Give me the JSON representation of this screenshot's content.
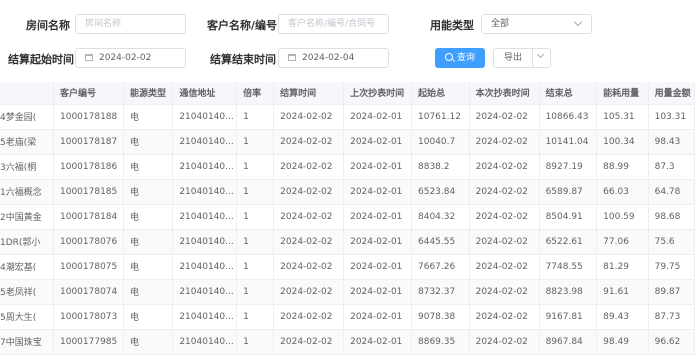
{
  "filters": {
    "room_name": {
      "label": "房间名称",
      "placeholder": "房间名称"
    },
    "customer": {
      "label": "客户名称/编号",
      "placeholder": "客户名称/编号/合同号"
    },
    "energy_type": {
      "label": "用能类型",
      "value": "全部"
    },
    "start": {
      "label": "结算起始时间",
      "value": "2024-02-02"
    },
    "end": {
      "label": "结算结束时间",
      "value": "2024-02-04"
    }
  },
  "buttons": {
    "query": "查询",
    "export": "导出"
  },
  "table": {
    "headers": [
      "",
      "客户编号",
      "能源类型",
      "通信地址",
      "倍率",
      "结算时间",
      "上次抄表时间",
      "起始总",
      "本次抄表时间",
      "结束总",
      "能耗用量",
      "用量金额"
    ],
    "rows": [
      [
        "4梦金园(",
        "1000178188",
        "电",
        "21040140...",
        "1",
        "2024-02-02",
        "2024-02-01",
        "10761.12",
        "2024-02-02",
        "10866.43",
        "105.31",
        "103.31"
      ],
      [
        "5老庙(梁",
        "1000178187",
        "电",
        "21040140...",
        "1",
        "2024-02-02",
        "2024-02-01",
        "10040.7",
        "2024-02-02",
        "10141.04",
        "100.34",
        "98.43"
      ],
      [
        "3六福(桐",
        "1000178186",
        "电",
        "21040140...",
        "1",
        "2024-02-02",
        "2024-02-01",
        "8838.2",
        "2024-02-02",
        "8927.19",
        "88.99",
        "87.3"
      ],
      [
        "1六福概念",
        "1000178185",
        "电",
        "21040140...",
        "1",
        "2024-02-02",
        "2024-02-01",
        "6523.84",
        "2024-02-02",
        "6589.87",
        "66.03",
        "64.78"
      ],
      [
        "2中国黄金",
        "1000178184",
        "电",
        "21040140...",
        "1",
        "2024-02-02",
        "2024-02-01",
        "8404.32",
        "2024-02-02",
        "8504.91",
        "100.59",
        "98.68"
      ],
      [
        "1DR(郭小",
        "1000178076",
        "电",
        "21040140...",
        "1",
        "2024-02-02",
        "2024-02-01",
        "6445.55",
        "2024-02-02",
        "6522.61",
        "77.06",
        "75.6"
      ],
      [
        "4潮宏基(",
        "1000178075",
        "电",
        "21040140...",
        "1",
        "2024-02-02",
        "2024-02-01",
        "7667.26",
        "2024-02-02",
        "7748.55",
        "81.29",
        "79.75"
      ],
      [
        "5老凤祥(",
        "1000178074",
        "电",
        "21040140...",
        "1",
        "2024-02-02",
        "2024-02-01",
        "8732.37",
        "2024-02-02",
        "8823.98",
        "91.61",
        "89.87"
      ],
      [
        "5周大生(",
        "1000178073",
        "电",
        "21040140...",
        "1",
        "2024-02-02",
        "2024-02-01",
        "9078.38",
        "2024-02-02",
        "9167.81",
        "89.43",
        "87.73"
      ],
      [
        "7中国珠宝",
        "1000177985",
        "电",
        "21040140...",
        "1",
        "2024-02-02",
        "2024-02-01",
        "8869.35",
        "2024-02-02",
        "8967.84",
        "98.49",
        "96.62"
      ]
    ]
  }
}
